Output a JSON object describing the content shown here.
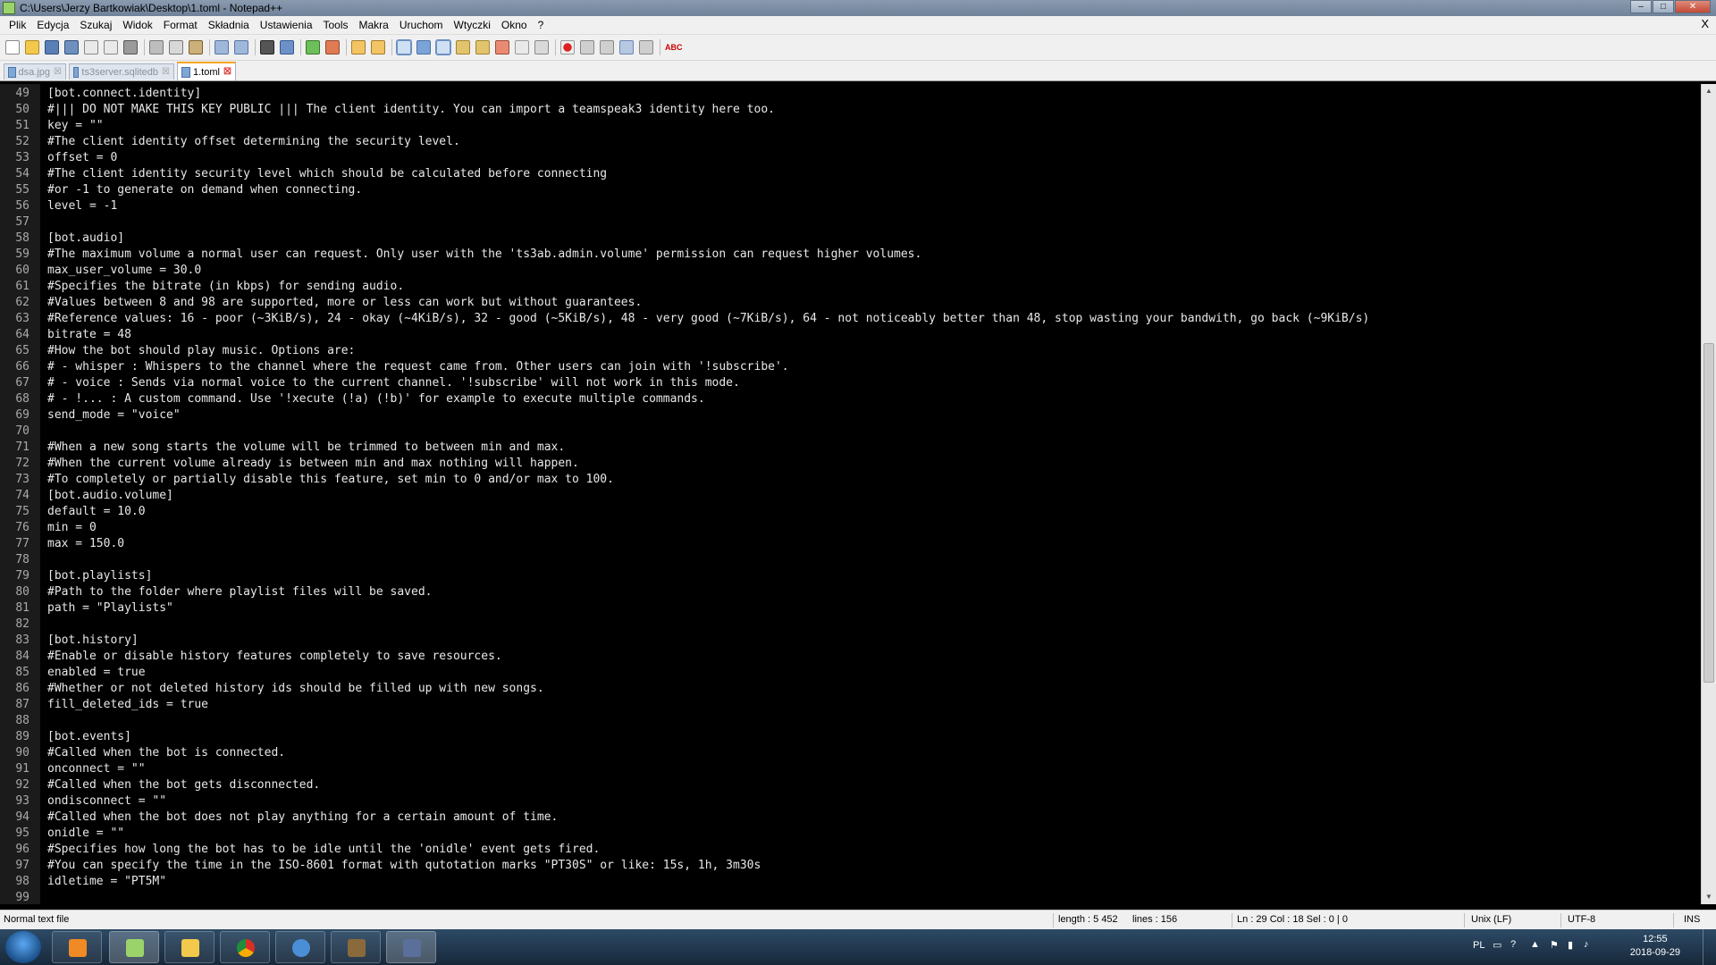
{
  "window": {
    "title": "C:\\Users\\Jerzy Bartkowiak\\Desktop\\1.toml - Notepad++",
    "buttons": {
      "minimize": "–",
      "maximize": "□",
      "close": "✕"
    }
  },
  "menu": {
    "items": [
      "Plik",
      "Edycja",
      "Szukaj",
      "Widok",
      "Format",
      "Składnia",
      "Ustawienia",
      "Tools",
      "Makra",
      "Uruchom",
      "Wtyczki",
      "Okno",
      "?"
    ],
    "close": "X"
  },
  "toolbar": {
    "spellcheck_label": "ABC"
  },
  "tabs": [
    {
      "label": "dsa.jpg",
      "active": false
    },
    {
      "label": "ts3server.sqlitedb",
      "active": false
    },
    {
      "label": "1.toml",
      "active": true
    }
  ],
  "editor": {
    "lines": [
      {
        "n": "49",
        "text": "[bot.connect.identity]"
      },
      {
        "n": "50",
        "text": "#||| DO NOT MAKE THIS KEY PUBLIC ||| The client identity. You can import a teamspeak3 identity here too."
      },
      {
        "n": "51",
        "text": "key = \"\""
      },
      {
        "n": "52",
        "text": "#The client identity offset determining the security level."
      },
      {
        "n": "53",
        "text": "offset = 0"
      },
      {
        "n": "54",
        "text": "#The client identity security level which should be calculated before connecting"
      },
      {
        "n": "55",
        "text": "#or -1 to generate on demand when connecting."
      },
      {
        "n": "56",
        "text": "level = -1"
      },
      {
        "n": "57",
        "text": ""
      },
      {
        "n": "58",
        "text": "[bot.audio]"
      },
      {
        "n": "59",
        "text": "#The maximum volume a normal user can request. Only user with the 'ts3ab.admin.volume' permission can request higher volumes."
      },
      {
        "n": "60",
        "text": "max_user_volume = 30.0"
      },
      {
        "n": "61",
        "text": "#Specifies the bitrate (in kbps) for sending audio."
      },
      {
        "n": "62",
        "text": "#Values between 8 and 98 are supported, more or less can work but without guarantees."
      },
      {
        "n": "63",
        "text": "#Reference values: 16 - poor (~3KiB/s), 24 - okay (~4KiB/s), 32 - good (~5KiB/s), 48 - very good (~7KiB/s), 64 - not noticeably better than 48, stop wasting your bandwith, go back (~9KiB/s)"
      },
      {
        "n": "64",
        "text": "bitrate = 48"
      },
      {
        "n": "65",
        "text": "#How the bot should play music. Options are:"
      },
      {
        "n": "66",
        "text": "# - whisper : Whispers to the channel where the request came from. Other users can join with '!subscribe'."
      },
      {
        "n": "67",
        "text": "# - voice : Sends via normal voice to the current channel. '!subscribe' will not work in this mode."
      },
      {
        "n": "68",
        "text": "# - !... : A custom command. Use '!xecute (!a) (!b)' for example to execute multiple commands."
      },
      {
        "n": "69",
        "text": "send_mode = \"voice\""
      },
      {
        "n": "70",
        "text": ""
      },
      {
        "n": "71",
        "text": "#When a new song starts the volume will be trimmed to between min and max."
      },
      {
        "n": "72",
        "text": "#When the current volume already is between min and max nothing will happen."
      },
      {
        "n": "73",
        "text": "#To completely or partially disable this feature, set min to 0 and/or max to 100."
      },
      {
        "n": "74",
        "text": "[bot.audio.volume]"
      },
      {
        "n": "75",
        "text": "default = 10.0"
      },
      {
        "n": "76",
        "text": "min = 0"
      },
      {
        "n": "77",
        "text": "max = 150.0"
      },
      {
        "n": "78",
        "text": ""
      },
      {
        "n": "79",
        "text": "[bot.playlists]"
      },
      {
        "n": "80",
        "text": "#Path to the folder where playlist files will be saved."
      },
      {
        "n": "81",
        "text": "path = \"Playlists\""
      },
      {
        "n": "82",
        "text": ""
      },
      {
        "n": "83",
        "text": "[bot.history]"
      },
      {
        "n": "84",
        "text": "#Enable or disable history features completely to save resources."
      },
      {
        "n": "85",
        "text": "enabled = true"
      },
      {
        "n": "86",
        "text": "#Whether or not deleted history ids should be filled up with new songs."
      },
      {
        "n": "87",
        "text": "fill_deleted_ids = true"
      },
      {
        "n": "88",
        "text": ""
      },
      {
        "n": "89",
        "text": "[bot.events]"
      },
      {
        "n": "90",
        "text": "#Called when the bot is connected."
      },
      {
        "n": "91",
        "text": "onconnect = \"\""
      },
      {
        "n": "92",
        "text": "#Called when the bot gets disconnected."
      },
      {
        "n": "93",
        "text": "ondisconnect = \"\""
      },
      {
        "n": "94",
        "text": "#Called when the bot does not play anything for a certain amount of time."
      },
      {
        "n": "95",
        "text": "onidle = \"\""
      },
      {
        "n": "96",
        "text": "#Specifies how long the bot has to be idle until the 'onidle' event gets fired."
      },
      {
        "n": "97",
        "text": "#You can specify the time in the ISO-8601 format with qutotation marks \"PT30S\" or like: 15s, 1h, 3m30s"
      },
      {
        "n": "98",
        "text": "idletime = \"PT5M\""
      },
      {
        "n": "99",
        "text": ""
      }
    ]
  },
  "status": {
    "file_type": "Normal text file",
    "length": "length : 5 452",
    "lines": "lines : 156",
    "position": "Ln : 29    Col : 18    Sel : 0 | 0",
    "eol": "Unix (LF)",
    "encoding": "UTF-8",
    "mode": "INS"
  },
  "taskbar": {
    "lang": "PL",
    "time": "12:55",
    "date": "2018-09-29"
  }
}
